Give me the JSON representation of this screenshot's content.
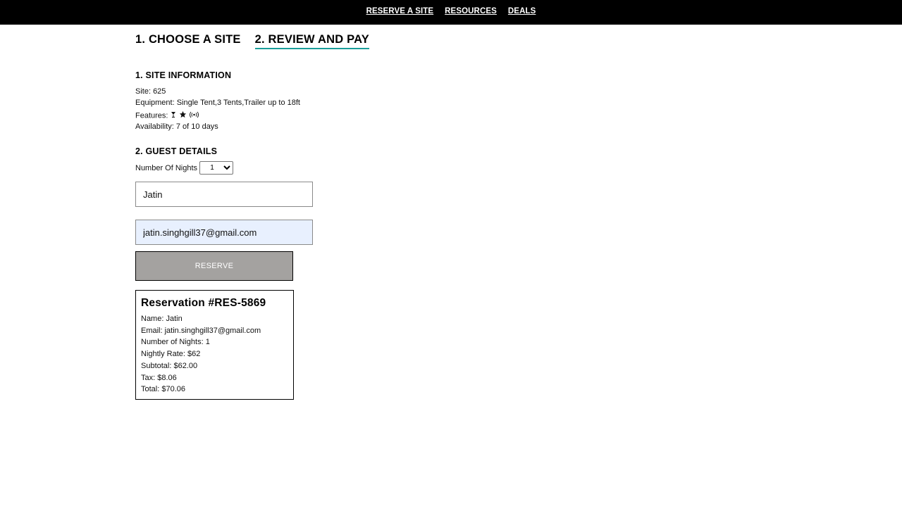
{
  "nav": {
    "links": [
      "RESERVE A SITE",
      "RESOURCES",
      "DEALS"
    ]
  },
  "steps": [
    {
      "label": "1. CHOOSE A SITE",
      "active": false
    },
    {
      "label": "2. REVIEW AND PAY",
      "active": true
    }
  ],
  "site_info": {
    "title": "1. SITE INFORMATION",
    "site": "Site: 625",
    "equipment": "Equipment: Single Tent,3 Tents,Trailer up to 18ft",
    "features_label": "Features:",
    "feature_icons": [
      "drink-icon",
      "star-icon",
      "signal-icon"
    ],
    "availability": "Availability: 7 of 10 days"
  },
  "guest": {
    "title": "2. GUEST DETAILS",
    "nights_label": "Number Of Nights",
    "nights_value": "1",
    "name_value": "Jatin",
    "email_value": "jatin.singhgill37@gmail.com",
    "reserve_label": "RESERVE"
  },
  "reservation": {
    "title": "Reservation #RES-5869",
    "name": "Name: Jatin",
    "email": "Email: jatin.singhgill37@gmail.com",
    "nights": "Number of Nights: 1",
    "rate": "Nightly Rate: $62",
    "subtotal": "Subtotal: $62.00",
    "tax": "Tax: $8.06",
    "total": "Total: $70.06"
  },
  "colors": {
    "topbar": "#000000",
    "active_tab_underline": "#1a9e9a",
    "button_bg": "#a4a2a0",
    "autofill_bg": "#e8f0fe"
  }
}
